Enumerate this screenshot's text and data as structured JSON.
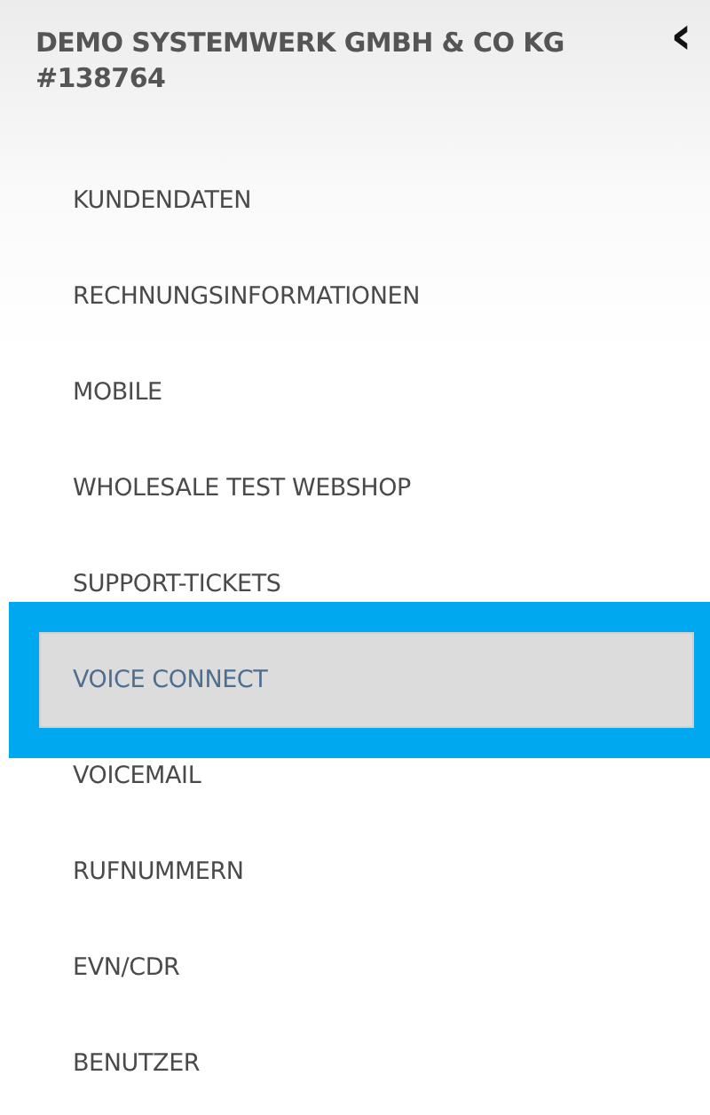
{
  "sidebar": {
    "title": "DEMO SYSTEMWERK GMBH & CO KG #138764",
    "collapse_icon": "‹",
    "items": [
      {
        "label": "KUNDENDATEN",
        "selected": false
      },
      {
        "label": "RECHNUNGSINFORMATIONEN",
        "selected": false
      },
      {
        "label": "MOBILE",
        "selected": false
      },
      {
        "label": "WHOLESALE TEST WEBSHOP",
        "selected": false
      },
      {
        "label": "SUPPORT-TICKETS",
        "selected": false
      },
      {
        "label": "VOICE CONNECT",
        "selected": true
      },
      {
        "label": "VOICEMAIL",
        "selected": false
      },
      {
        "label": "RUFNUMMERN",
        "selected": false
      },
      {
        "label": "EVN/CDR",
        "selected": false
      },
      {
        "label": "BENUTZER",
        "selected": false
      }
    ]
  }
}
